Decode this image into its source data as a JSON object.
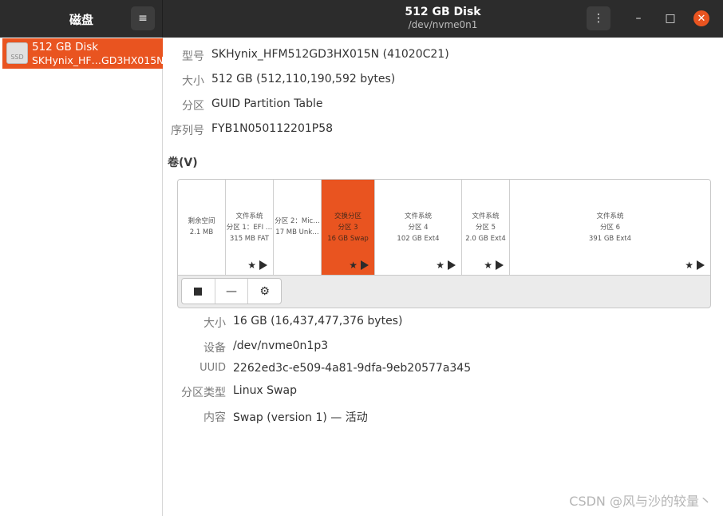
{
  "app": {
    "title": "磁盘"
  },
  "window": {
    "title": "512 GB Disk",
    "subtitle": "/dev/nvme0n1"
  },
  "header": {
    "menu_icon": "hamburger-icon",
    "kebab_icon": "vertical-dots-icon"
  },
  "sidebar": {
    "items": [
      {
        "icon_label": "SSD",
        "name": "512 GB Disk",
        "model": "SKHynix_HF…GD3HX015N"
      }
    ]
  },
  "disk_info": {
    "model_label": "型号",
    "model_value": "SKHynix_HFM512GD3HX015N (41020C21)",
    "size_label": "大小",
    "size_value": "512 GB (512,110,190,592 bytes)",
    "partitioning_label": "分区",
    "partitioning_value": "GUID Partition Table",
    "serial_label": "序列号",
    "serial_value": "FYB1N050112201P58"
  },
  "volumes": {
    "heading": "卷(V)",
    "partitions": [
      {
        "line1": "剩余空间",
        "line2": "2.1 MB",
        "line3": ""
      },
      {
        "line1": "文件系统",
        "line2": "分区 1：EFI …",
        "line3": "315 MB FAT"
      },
      {
        "line1": "",
        "line2": "分区 2：Mic…",
        "line3": "17 MB Unk…"
      },
      {
        "line1": "交换分区",
        "line2": "分区 3",
        "line3": "16 GB Swap"
      },
      {
        "line1": "文件系统",
        "line2": "分区 4",
        "line3": "102 GB Ext4"
      },
      {
        "line1": "文件系统",
        "line2": "分区 5",
        "line3": "2.0 GB Ext4"
      },
      {
        "line1": "文件系统",
        "line2": "分区 6",
        "line3": "391 GB Ext4"
      }
    ],
    "toolbar": {
      "minus_label": "—"
    }
  },
  "selected_volume": {
    "size_label": "大小",
    "size_value": "16 GB (16,437,477,376 bytes)",
    "device_label": "设备",
    "device_value": "/dev/nvme0n1p3",
    "uuid_label": "UUID",
    "uuid_value": "2262ed3c-e509-4a81-9dfa-9eb20577a345",
    "type_label": "分区类型",
    "type_value": "Linux Swap",
    "contents_label": "内容",
    "contents_value": "Swap (version 1) — 活动"
  },
  "watermark": "CSDN @风与沙的较量丶",
  "colors": {
    "accent": "#e95420",
    "header_bg": "#2c2c2c"
  }
}
